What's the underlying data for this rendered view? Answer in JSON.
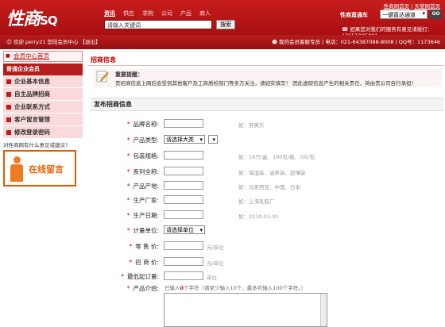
{
  "header": {
    "logo_main": "性商",
    "logo_sub": "SQ",
    "toplinks": [
      "性商网首页",
      "天使网首页"
    ],
    "search_tabs": [
      "资讯",
      "供应",
      "求购",
      "公司",
      "产品",
      "商人"
    ],
    "search_placeholder": "请输入关键词",
    "search_button": "搜索",
    "express_label": "性商直通车",
    "express_select": "一键直达通道",
    "go_button": "GO",
    "complaint_text": "如果您对我们的服务有意见请拨打：13651905001"
  },
  "statusbar": {
    "welcome": "欢迎 perry21 您陆会员中心",
    "logout": "【退出】",
    "account_info": "我的会员客服专员 | 电话：021-64387088-8008 | QQ号：1173646"
  },
  "sidebar": {
    "home": "会员中心首页",
    "section_title": "普通企业会员",
    "items": [
      "企业基本信息",
      "自主品牌招商",
      "企业联系方式",
      "客户留言管理",
      "修改登录密码"
    ],
    "feedback_question": "对性商网有什么意见或建议?",
    "online_message": "在线留言"
  },
  "main": {
    "page_title": "招商信息",
    "notice_title": "重要提醒：",
    "notice_text": "贵招商信息上网后会受到其他客户及工商质检部门等多方关注，请如实填写！ 因此虚假信息产生的相关责任，将由贵公司自行承担！",
    "section_title": "发布招商信息"
  },
  "form": {
    "brand_name": {
      "label": "品牌名称:",
      "hint": "如：舒爽乐"
    },
    "category": {
      "label": "产品类型:",
      "select": "请选择大类"
    },
    "packaging": {
      "label": "包装规格:",
      "hint": "如：16只/盒、100克/瓶、3片/包"
    },
    "series": {
      "label": "系列全称:",
      "hint": "如：保湿装、滋养装、超薄装"
    },
    "origin": {
      "label": "产品产地:",
      "hint": "如：马来西亚、中国、日本"
    },
    "manufacturer": {
      "label": "生产厂家:",
      "hint": "如：上海乳胶厂"
    },
    "production_date": {
      "label": "生产日期:",
      "hint": "如：2010-01-01"
    },
    "unit": {
      "label": "计量单位:",
      "select": "请选择单位"
    },
    "retail_price": {
      "label": "零 售 价:",
      "unit": "元/单位"
    },
    "wholesale_price": {
      "label": "招 商 价:",
      "unit": "元/单位"
    },
    "min_order": {
      "label": "最低起订量:",
      "unit": "单位"
    },
    "intro": {
      "label": "产品介绍:",
      "hint_prefix": "已输入",
      "hint_count": "0",
      "hint_suffix": "个字符（请至少输入10个，最多可输入100个字符。）"
    }
  }
}
